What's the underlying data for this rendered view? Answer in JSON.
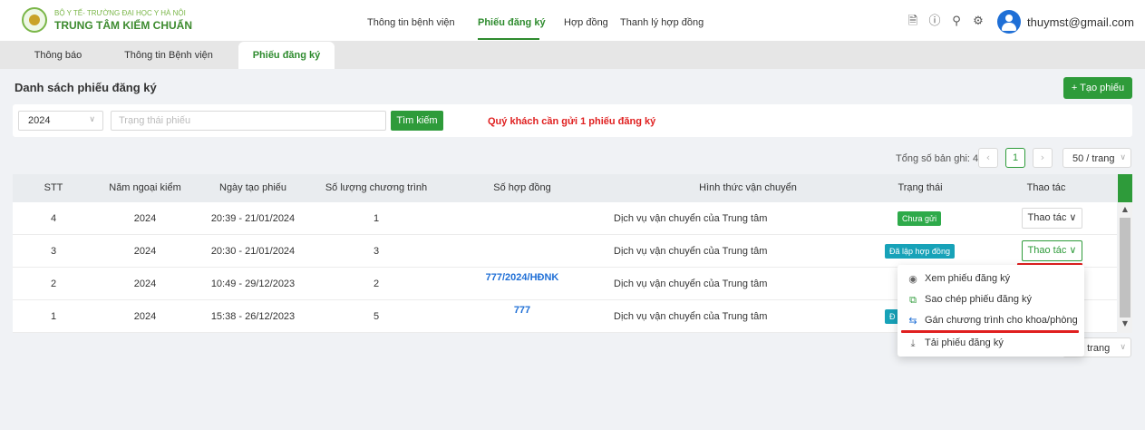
{
  "org": {
    "line1": "BỘ Y TẾ- TRƯỜNG ĐẠI HỌC Y HÀ NỘI",
    "line2": "TRUNG TÂM KIỂM CHUẨN"
  },
  "topnav": {
    "items": [
      "Thông tin bệnh viện",
      "Phiếu đăng ký",
      "Hợp đồng",
      "Thanh lý hợp đồng"
    ],
    "active": "Phiếu đăng ký"
  },
  "user": {
    "email": "thuymst@gmail.com"
  },
  "icons": {
    "doc": "document-icon",
    "help": "help-circle-icon",
    "bell": "bell-icon",
    "settings": "gear-icon",
    "avatar": "user-avatar-icon"
  },
  "tabs": {
    "items": [
      "Thông báo",
      "Thông tin Bệnh viện",
      "Phiếu đăng ký"
    ],
    "active": "Phiếu đăng ký"
  },
  "page": {
    "title": "Danh sách phiếu đăng ký",
    "create_label": "+ Tạo phiếu"
  },
  "filters": {
    "year_value": "2024",
    "status_placeholder": "Trạng thái phiếu",
    "search_label": "Tìm kiếm",
    "notice": "Quý khách cần gửi 1 phiếu đăng ký"
  },
  "pagination": {
    "total_label": "Tổng số bản ghi: 4",
    "current_page": "1",
    "page_size": "50 / trang",
    "page_size_bottom": "/ trang"
  },
  "table": {
    "headers": [
      "STT",
      "Năm ngoại kiểm",
      "Ngày tạo phiếu",
      "Số lượng chương trình",
      "Số hợp đồng",
      "Hình thức vận chuyển",
      "Trạng thái",
      "Thao tác"
    ],
    "rows": [
      {
        "stt": "4",
        "year": "2024",
        "created": "20:39 - 21/01/2024",
        "count": "1",
        "contract": "",
        "shipping": "Dịch vụ vận chuyển của Trung tâm",
        "status": "Chưa gửi",
        "action": "Thao tác ∨"
      },
      {
        "stt": "3",
        "year": "2024",
        "created": "20:30 - 21/01/2024",
        "count": "3",
        "contract": "",
        "shipping": "Dịch vụ vận chuyển của Trung tâm",
        "status": "Đã lập hợp đồng",
        "action": "Thao tác ∨"
      },
      {
        "stt": "2",
        "year": "2024",
        "created": "10:49 - 29/12/2023",
        "count": "2",
        "contract": "777/2024/HĐNK",
        "shipping": "Dịch vụ vận chuyển của Trung tâm",
        "status": "",
        "action": ""
      },
      {
        "stt": "1",
        "year": "2024",
        "created": "15:38 - 26/12/2023",
        "count": "5",
        "contract": "777",
        "shipping": "Dịch vụ vận chuyển của Trung tâm",
        "status": "Đ",
        "action": ""
      }
    ]
  },
  "dropdown": {
    "items": [
      {
        "label": "Xem phiếu đăng ký",
        "icon": "eye-icon"
      },
      {
        "label": "Sao chép phiếu đăng ký",
        "icon": "copy-icon"
      },
      {
        "label": "Gán chương trình cho khoa/phòng",
        "icon": "swap-icon"
      },
      {
        "label": "Tải phiếu đăng ký",
        "icon": "download-icon"
      }
    ]
  },
  "colors": {
    "brand_green": "#2e9b3a",
    "alert_red": "#e02020",
    "link_blue": "#1f6fd6",
    "status_draft": "#2eaa4a",
    "status_contracted": "#17a2b8"
  }
}
